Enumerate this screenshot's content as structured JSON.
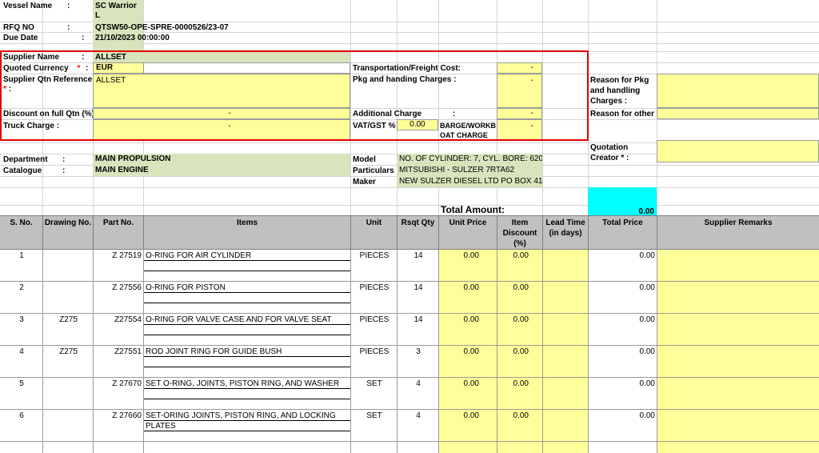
{
  "header": {
    "vessel_label": "Vessel Name",
    "vessel_value": "SC Warrior",
    "vessel_value_wrap": "L",
    "rfq_label": "RFQ NO",
    "rfq_value": "QTSW50-OPE-SPRE-0000526/23-07",
    "due_label": "Due Date",
    "due_value": "21/10/2023 00:00:00",
    "colon": ":"
  },
  "supplier": {
    "name_label": "Supplier Name",
    "name_value": "ALLSET",
    "currency_label": "Quoted Currency",
    "currency_value": "EUR",
    "qtn_ref_label": "Supplier Qtn Reference",
    "qtn_ref_value": "ALLSET",
    "discount_label": "Discount on full Qtn  (%)",
    "discount_value": "-",
    "truck_label": "Truck Charge :",
    "truck_value": "-",
    "transport_label": "Transportation/Freight Cost:",
    "transport_value": "-",
    "pkg_label": "Pkg and handing Charges  :",
    "pkg_value": "-",
    "additional_label": "Additional Charge",
    "additional_value": "-",
    "vat_label": "VAT/GST %",
    "vat_value": "0.00",
    "barge_label_1": "BARGE/WORKB",
    "barge_label_2": "OAT CHARGE",
    "barge_value": "-",
    "required_mark": "*"
  },
  "reasons": {
    "pkg_reason_1": "Reason for Pkg",
    "pkg_reason_2": "and handling",
    "pkg_reason_3": "Charges :",
    "other_reason": "Reason for other",
    "creator_1": "Quotation",
    "creator_2": "Creator * :"
  },
  "equipment": {
    "dept_label": "Department",
    "dept_value": "MAIN PROPULSION",
    "catalogue_label": "Catalogue",
    "catalogue_value": "MAIN ENGINE",
    "model_label": "Model",
    "model_value": "NO. OF CYLINDER: 7, CYL. BORE: 620",
    "particulars_label": "Particulars",
    "particulars_value": "MITSUBISHI - SULZER 7RTA62",
    "maker_label": "Maker",
    "maker_value": "NEW SULZER DIESEL LTD PO BOX 41"
  },
  "totals": {
    "label": "Total Amount:",
    "value": "0.00"
  },
  "table": {
    "headers": {
      "sno": "S. No.",
      "drawing": "Drawing No.",
      "part": "Part No.",
      "items": "Items",
      "unit": "Unit",
      "qty": "Rsqt Qty",
      "price": "Unit Price",
      "discount_1": "Item",
      "discount_2": "Discount",
      "discount_3": "(%)",
      "lead_1": "Lead Time",
      "lead_2": "(in days)",
      "total": "Total Price",
      "remarks": "Supplier Remarks"
    },
    "rows": [
      {
        "sno": "1",
        "drawing": "",
        "part": "Z 27519",
        "item": "O-RING FOR AIR CYLINDER",
        "item2": "",
        "unit": "PIECES",
        "qty": "14",
        "price": "0.00",
        "discount": "0.00",
        "total": "0.00"
      },
      {
        "sno": "2",
        "drawing": "",
        "part": "Z 27556",
        "item": "O-RING FOR PISTON",
        "item2": "",
        "unit": "PIECES",
        "qty": "14",
        "price": "0.00",
        "discount": "0.00",
        "total": "0.00"
      },
      {
        "sno": "3",
        "drawing": "Z275",
        "part": "Z27554",
        "item": "O-RING FOR VALVE CASE AND FOR VALVE SEAT",
        "item2": "",
        "unit": "PIECES",
        "qty": "14",
        "price": "0.00",
        "discount": "0.00",
        "total": "0.00"
      },
      {
        "sno": "4",
        "drawing": "Z275",
        "part": "Z27551",
        "item": "ROD JOINT RING FOR GUIDE BUSH",
        "item2": "",
        "unit": "PIECES",
        "qty": "3",
        "price": "0.00",
        "discount": "0.00",
        "total": "0.00"
      },
      {
        "sno": "5",
        "drawing": "",
        "part": "Z 27670",
        "item": "SET O-RING, JOINTS, PISTON RING, AND WASHER",
        "item2": "",
        "unit": "SET",
        "qty": "4",
        "price": "0.00",
        "discount": "0.00",
        "total": "0.00"
      },
      {
        "sno": "6",
        "drawing": "",
        "part": "Z 27660",
        "item": "SET-ORING JOINTS, PISTON RING, AND LOCKING",
        "item2": "PLATES",
        "unit": "SET",
        "qty": "4",
        "price": "0.00",
        "discount": "0.00",
        "total": "0.00"
      }
    ]
  },
  "colors": {
    "label_green": "#d8e4bc",
    "input_yellow": "#ffff99",
    "header_gray": "#c0c0c0",
    "total_cyan": "#00ffff",
    "required_red": "#ff0000",
    "section_border": "#e00000"
  }
}
